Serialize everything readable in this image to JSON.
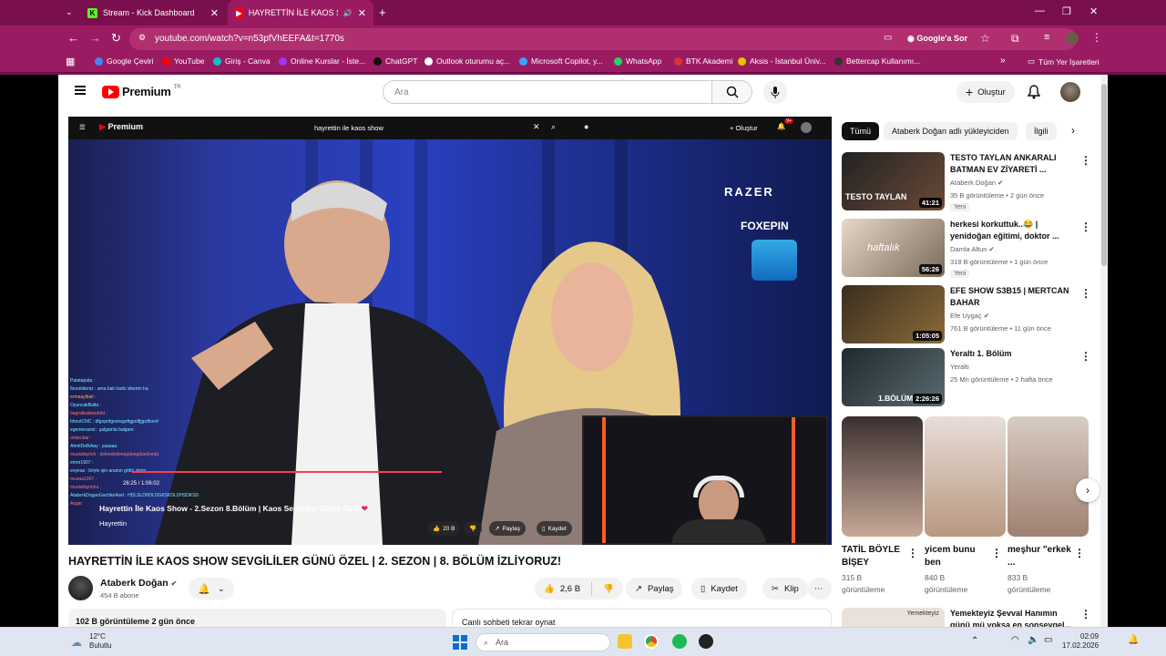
{
  "browser": {
    "tabs": [
      {
        "title": "Stream - Kick Dashboard",
        "active": false
      },
      {
        "title": "HAYRETTİN İLE KAOS SHOW",
        "active": true
      }
    ],
    "url": "youtube.com/watch?v=n53pfVhEEFA&t=1770s",
    "google_sor": "Google'a Sor",
    "bookmarks": [
      "Google Çeviri",
      "YouTube",
      "Giriş - Canva",
      "Online Kurslar - İste...",
      "ChatGPT",
      "Outlook oturumu aç...",
      "Microsoft Copilot, y...",
      "WhatsApp",
      "BTK Akademi",
      "Aksis - İstanbul Üniv...",
      "Bettercap Kullanımı..."
    ],
    "all_bookmarks": "Tüm Yer İşaretleri"
  },
  "youtube": {
    "logo_text": "Premium",
    "logo_region": "TR",
    "search_placeholder": "Ara",
    "create_label": "Oluştur"
  },
  "player": {
    "inner_logo": "Premium",
    "inner_search": "hayrettin ile kaos show",
    "inner_create": "Oluştur",
    "inner_badge": "9+",
    "razer": "RAZER",
    "foxepin": "FOXEPIN",
    "overlay_title": "Hayrettin İle Kaos Show - 2.Sezon 8.Bölüm | Kaos Sevgililer Günü Özel",
    "overlay_time": "26:25 / 1:06:02",
    "overlay_channel": "Hayrettin",
    "overlay_like": "20 B",
    "overlay_share": "Paylaş",
    "overlay_save": "Kaydet",
    "chat_lines": [
      "Patatapata :",
      "Ibooeldeniz : ama bak harbi sikerim ha",
      "ermaaylbali :",
      "OyuncakBalta :",
      "bagratbarbardokt :",
      "bhnutCNC : dfgopofgooregoftgpolfjgpdfoenf",
      "egemenanni : şalgamla balgam",
      "onlarcbar :",
      "AhmtDefkAay : yaaaaa",
      "mustafayrich : dsfeededeeegdeegdsedyeda",
      "emre1907 :",
      "enyeas : böyle işin ananın göttü sikim",
      "musaa1907 :",
      "mustafayricha :",
      "AtaberkDoganGachkeAxel : HDLSLDHDLDGKSKDLDHSDKSD",
      "Asgar"
    ]
  },
  "video": {
    "title": "HAYRETTİN İLE KAOS SHOW SEVGİLİLER GÜNÜ ÖZEL | 2. SEZON | 8. BÖLÜM İZLİYORUZ!",
    "channel": "Ataberk Doğan",
    "subs": "454 B abone",
    "likes": "2,6 B",
    "share": "Paylaş",
    "save": "Kaydet",
    "clip": "Klip",
    "desc": "102 B görüntüleme  2 gün önce",
    "chat_replay": "Canlı sohbeti tekrar oynat"
  },
  "sidebar": {
    "chips": [
      "Tümü",
      "Ataberk Doğan adlı yükleyiciden",
      "İlgili"
    ],
    "recs": [
      {
        "title": "TESTO TAYLAN ANKARALI BATMAN EV ZİYARETİ ...",
        "channel": "Ataberk Doğan",
        "meta": "35 B görüntüleme • 2 gün önce",
        "badge": "Yeni",
        "duration": "41:21",
        "thumb_text": "TESTO TAYLAN"
      },
      {
        "title": "herkesi korkuttuk..😂 | yenidoğan eğitimi, doktor ...",
        "channel": "Damla Altun",
        "meta": "318 B görüntüleme • 1 gün önce",
        "badge": "Yeni",
        "duration": "56:26",
        "thumb_text": "haftalık"
      },
      {
        "title": "EFE SHOW S3B15 | MERTCAN BAHAR",
        "channel": "Efe Uygaç",
        "meta": "761 B görüntüleme • 11 gün önce",
        "badge": "",
        "duration": "1:05:05",
        "thumb_text": ""
      },
      {
        "title": "Yeraltı 1. Bölüm",
        "channel": "Yeraltı",
        "meta": "25 Mn görüntüleme • 2 hafta önce",
        "badge": "",
        "duration": "2:26:26",
        "thumb_text": "1.BÖLÜM"
      }
    ],
    "shorts": [
      {
        "title": "TATİL BÖYLE BİŞEY",
        "views": "315 B",
        "label": "görüntüleme"
      },
      {
        "title": "yicem bunu ben",
        "views": "840 B",
        "label": "görüntüleme"
      },
      {
        "title": "meşhur \"erkek ...",
        "views": "833 B",
        "label": "görüntüleme"
      }
    ],
    "rec5_title": "Yemekteyiz Şevval Hanımın günü mü yoksa en sonsevgel...",
    "rec5_thumb": "Yemekteyiz"
  },
  "taskbar": {
    "temp": "12°C",
    "weather": "Bulutlu",
    "search": "Ara",
    "time": "02:09",
    "date": "17.02.2026"
  },
  "colors": {
    "browser_frame": "#7a0f4e",
    "yt_red": "#ff0000",
    "progress": "#ff3b4e"
  }
}
